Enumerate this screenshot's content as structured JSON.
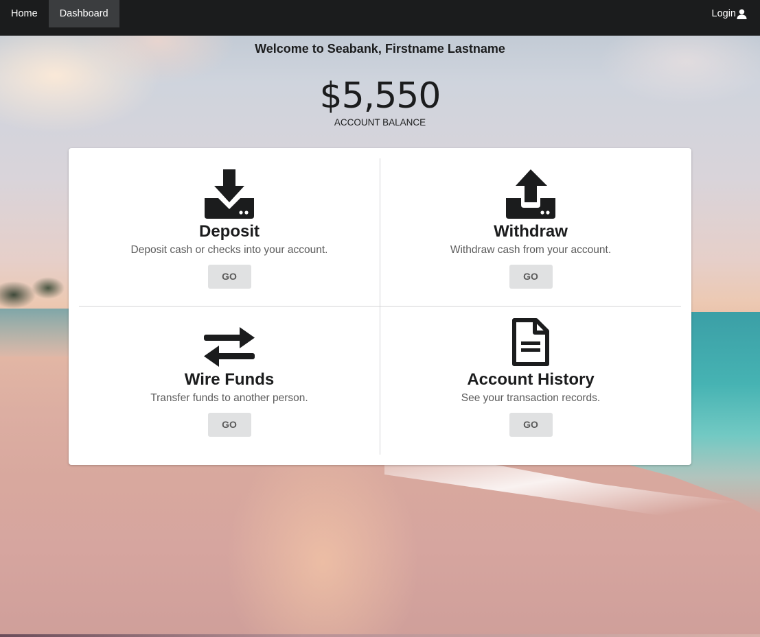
{
  "navbar": {
    "home_label": "Home",
    "dashboard_label": "Dashboard",
    "login_label": "Login"
  },
  "header": {
    "welcome": "Welcome to Seabank, Firstname Lastname",
    "balance": "$5,550",
    "balance_label": "ACCOUNT BALANCE"
  },
  "actions": [
    {
      "icon": "download-inbox-icon",
      "title": "Deposit",
      "description": "Deposit cash or checks into your account.",
      "button": "GO"
    },
    {
      "icon": "upload-inbox-icon",
      "title": "Withdraw",
      "description": "Withdraw cash from your account.",
      "button": "GO"
    },
    {
      "icon": "exchange-arrows-icon",
      "title": "Wire Funds",
      "description": "Transfer funds to another person.",
      "button": "GO"
    },
    {
      "icon": "file-document-icon",
      "title": "Account History",
      "description": "See your transaction records.",
      "button": "GO"
    }
  ],
  "colors": {
    "navbar_bg": "#1b1c1d",
    "active_nav_bg": "#3b3d3f",
    "button_bg": "#e0e1e2",
    "card_bg": "#ffffff",
    "text_dark": "#1b1c1d"
  }
}
